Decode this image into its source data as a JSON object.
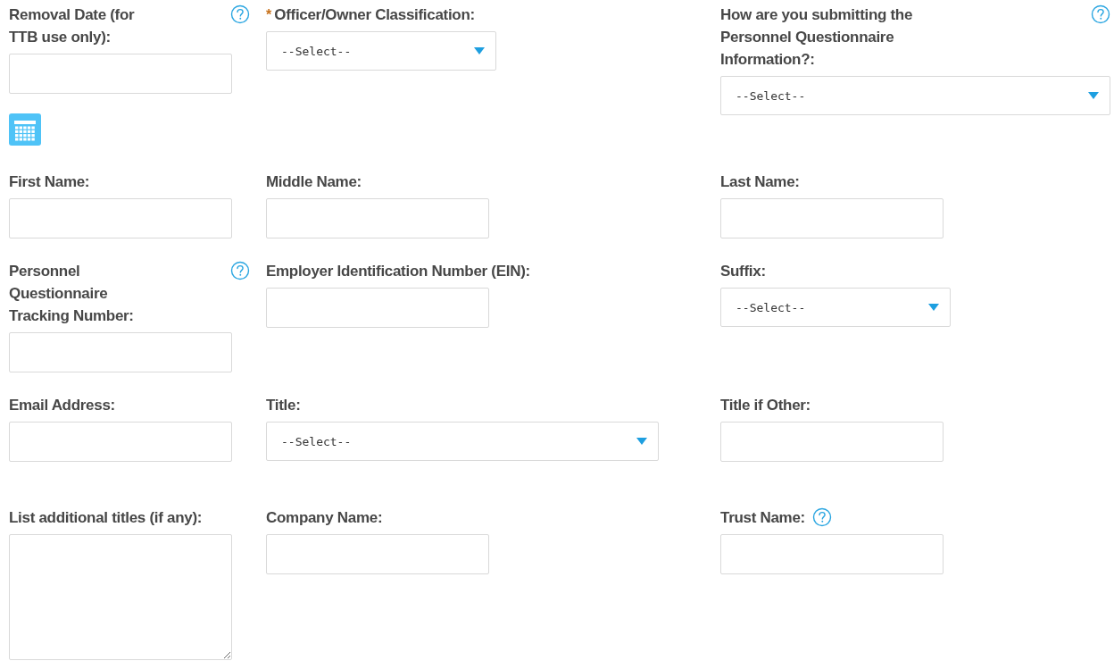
{
  "fields": [
    {
      "label": "Removal Date (for TTB use only):",
      "help": true,
      "control": {
        "kind": "date"
      }
    },
    {
      "label": "Officer/Owner Classification:",
      "required_mark": "*",
      "help": false,
      "control": {
        "kind": "select",
        "value": "--Select--"
      }
    },
    {
      "label": "How are you submitting the Personnel Questionnaire Information?:",
      "help": true,
      "control": {
        "kind": "select",
        "value": "--Select--"
      }
    },
    {
      "label": "First Name:",
      "help": false,
      "control": {
        "kind": "text"
      }
    },
    {
      "label": "Middle Name:",
      "help": false,
      "control": {
        "kind": "text"
      }
    },
    {
      "label": "Last Name:",
      "help": false,
      "control": {
        "kind": "text"
      }
    },
    {
      "label": "Personnel Questionnaire Tracking Number:",
      "help": true,
      "control": {
        "kind": "text"
      }
    },
    {
      "label": "Employer Identification Number (EIN):",
      "help": false,
      "control": {
        "kind": "text"
      }
    },
    {
      "label": "Suffix:",
      "help": false,
      "control": {
        "kind": "select",
        "value": "--Select--"
      }
    },
    {
      "label": "Email Address:",
      "help": false,
      "control": {
        "kind": "text"
      }
    },
    {
      "label": "Title:",
      "help": false,
      "control": {
        "kind": "select",
        "value": "--Select--"
      }
    },
    {
      "label": "Title if Other:",
      "help": false,
      "control": {
        "kind": "text"
      }
    },
    {
      "label": "List additional titles (if any):",
      "help": false,
      "control": {
        "kind": "textarea"
      }
    },
    {
      "label": "Company Name:",
      "help": false,
      "control": {
        "kind": "text"
      }
    },
    {
      "label": "Trust Name:",
      "help": true,
      "control": {
        "kind": "text"
      }
    }
  ]
}
